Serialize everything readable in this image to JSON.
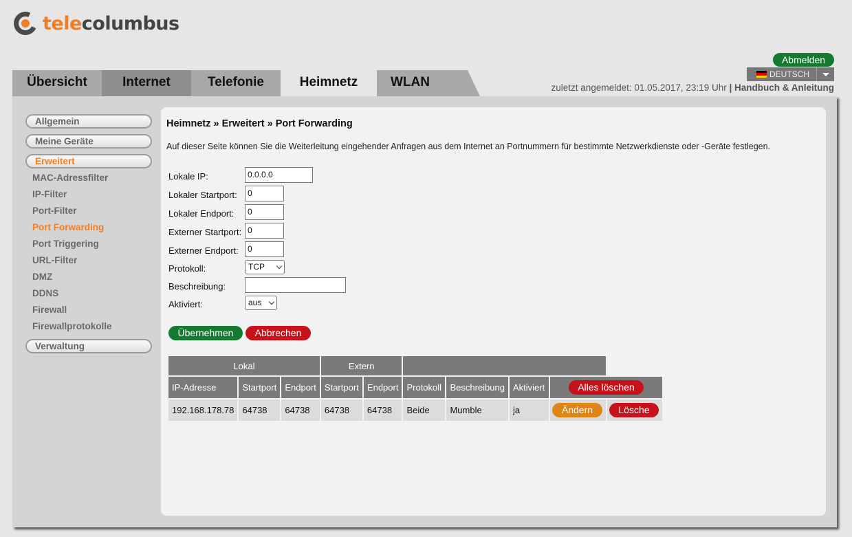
{
  "brand": {
    "part1": "tele",
    "part2": "columbus"
  },
  "header": {
    "logout": "Abmelden",
    "language": "DEUTSCH",
    "last_login": "zuletzt angemeldet: 01.05.2017, 23:19 Uhr",
    "separator": " | ",
    "manual": "Handbuch & Anleitung"
  },
  "tabs": [
    "Übersicht",
    "Internet",
    "Telefonie",
    "Heimnetz",
    "WLAN"
  ],
  "sidebar": {
    "sections": [
      "Allgemein",
      "Meine Geräte",
      "Erweitert",
      "Verwaltung"
    ],
    "links": [
      "MAC-Adressfilter",
      "IP-Filter",
      "Port-Filter",
      "Port Forwarding",
      "Port Triggering",
      "URL-Filter",
      "DMZ",
      "DDNS",
      "Firewall",
      "Firewallprotokolle"
    ]
  },
  "page": {
    "breadcrumb": "Heimnetz » Erweitert » Port Forwarding",
    "description": "Auf dieser Seite können Sie die Weiterleitung eingehender Anfragen aus dem Internet an Portnummern für bestimmte Netzwerkdienste oder -Geräte festlegen."
  },
  "form": {
    "local_ip": {
      "label": "Lokale IP:",
      "value": "0.0.0.0"
    },
    "local_start": {
      "label": "Lokaler Startport:",
      "value": "0"
    },
    "local_end": {
      "label": "Lokaler Endport:",
      "value": "0"
    },
    "ext_start": {
      "label": "Externer Startport:",
      "value": "0"
    },
    "ext_end": {
      "label": "Externer Endport:",
      "value": "0"
    },
    "protocol": {
      "label": "Protokoll:",
      "value": "TCP"
    },
    "description": {
      "label": "Beschreibung:",
      "value": ""
    },
    "active": {
      "label": "Aktiviert:",
      "value": "aus"
    },
    "apply": "Übernehmen",
    "cancel": "Abbrechen"
  },
  "table": {
    "group_local": "Lokal",
    "group_extern": "Extern",
    "headers": [
      "IP-Adresse",
      "Startport",
      "Endport",
      "Startport",
      "Endport",
      "Protokoll",
      "Beschreibung",
      "Aktiviert"
    ],
    "delete_all": "Alles löschen",
    "rows": [
      {
        "ip": "192.168.178.78",
        "lstart": "64738",
        "lend": "64738",
        "estart": "64738",
        "eend": "64738",
        "proto": "Beide",
        "desc": "Mumble",
        "active": "ja",
        "edit": "Ändern",
        "delete": "Lösche"
      }
    ]
  },
  "colors": {
    "accent": "#f07e26",
    "green": "#137a2f",
    "red": "#c8121b",
    "orange": "#e08513"
  }
}
